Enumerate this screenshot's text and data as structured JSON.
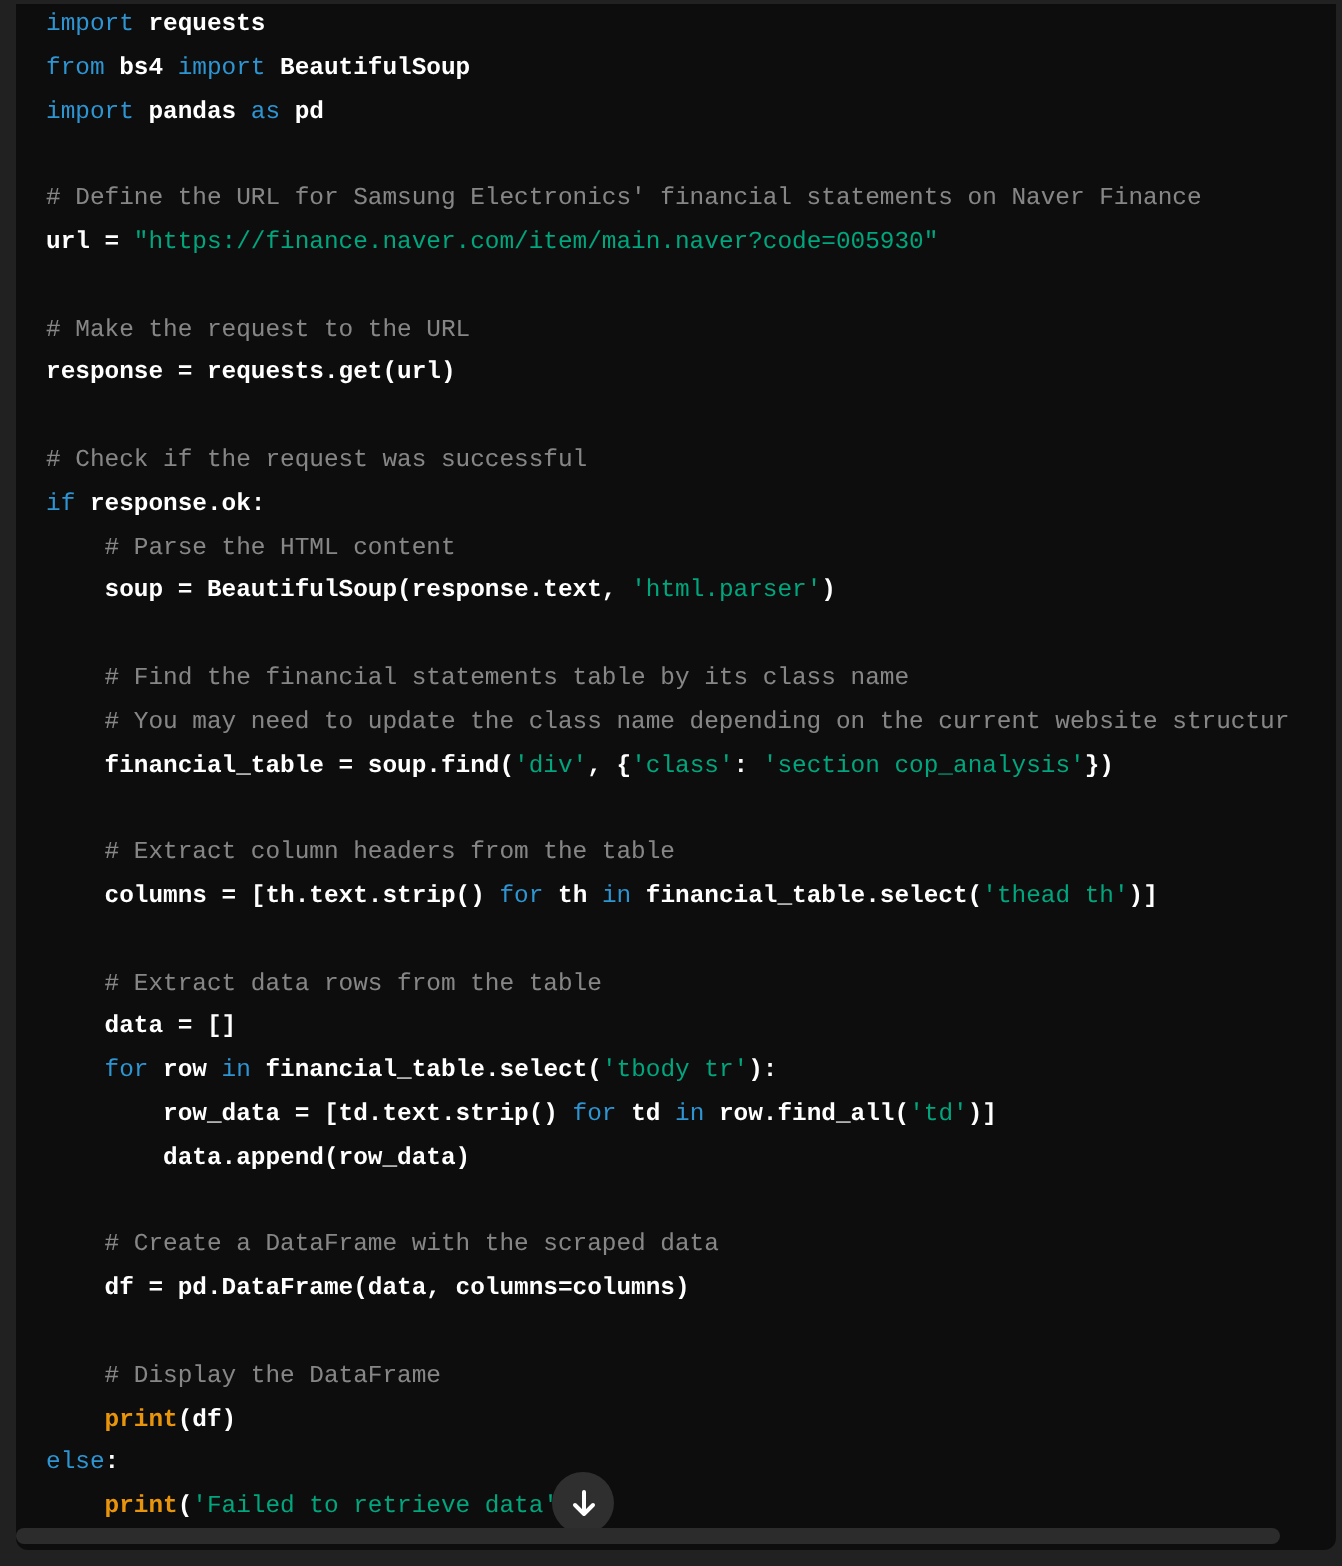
{
  "code_block": {
    "lines": [
      {
        "kind": "code",
        "tokens": [
          {
            "kind": "keyword",
            "text": "import"
          },
          {
            "kind": "plain",
            "text": " requests"
          }
        ]
      },
      {
        "kind": "code",
        "tokens": [
          {
            "kind": "keyword",
            "text": "from"
          },
          {
            "kind": "plain",
            "text": " bs4 "
          },
          {
            "kind": "keyword",
            "text": "import"
          },
          {
            "kind": "plain",
            "text": " BeautifulSoup"
          }
        ]
      },
      {
        "kind": "code",
        "tokens": [
          {
            "kind": "keyword",
            "text": "import"
          },
          {
            "kind": "plain",
            "text": " pandas "
          },
          {
            "kind": "keyword",
            "text": "as"
          },
          {
            "kind": "plain",
            "text": " pd"
          }
        ]
      },
      {
        "kind": "blank"
      },
      {
        "kind": "code",
        "tokens": [
          {
            "kind": "comment",
            "text": "# Define the URL for Samsung Electronics' financial statements on Naver Finance"
          }
        ]
      },
      {
        "kind": "code",
        "tokens": [
          {
            "kind": "plain",
            "text": "url = "
          },
          {
            "kind": "string",
            "text": "\"https://finance.naver.com/item/main.naver?code=005930\""
          }
        ]
      },
      {
        "kind": "blank"
      },
      {
        "kind": "code",
        "tokens": [
          {
            "kind": "comment",
            "text": "# Make the request to the URL"
          }
        ]
      },
      {
        "kind": "code",
        "tokens": [
          {
            "kind": "plain",
            "text": "response = requests.get(url)"
          }
        ]
      },
      {
        "kind": "blank"
      },
      {
        "kind": "code",
        "tokens": [
          {
            "kind": "comment",
            "text": "# Check if the request was successful"
          }
        ]
      },
      {
        "kind": "code",
        "tokens": [
          {
            "kind": "keyword",
            "text": "if"
          },
          {
            "kind": "plain",
            "text": " response.ok:"
          }
        ]
      },
      {
        "kind": "code",
        "tokens": [
          {
            "kind": "comment",
            "text": "    # Parse the HTML content"
          }
        ]
      },
      {
        "kind": "code",
        "tokens": [
          {
            "kind": "plain",
            "text": "    soup = BeautifulSoup(response.text, "
          },
          {
            "kind": "string",
            "text": "'html.parser'"
          },
          {
            "kind": "plain",
            "text": ")"
          }
        ]
      },
      {
        "kind": "blank"
      },
      {
        "kind": "code",
        "tokens": [
          {
            "kind": "comment",
            "text": "    # Find the financial statements table by its class name"
          }
        ]
      },
      {
        "kind": "code",
        "tokens": [
          {
            "kind": "comment",
            "text": "    # You may need to update the class name depending on the current website structur"
          }
        ]
      },
      {
        "kind": "code",
        "tokens": [
          {
            "kind": "plain",
            "text": "    financial_table = soup.find("
          },
          {
            "kind": "string",
            "text": "'div'"
          },
          {
            "kind": "plain",
            "text": ", {"
          },
          {
            "kind": "string",
            "text": "'class'"
          },
          {
            "kind": "plain",
            "text": ": "
          },
          {
            "kind": "string",
            "text": "'section cop_analysis'"
          },
          {
            "kind": "plain",
            "text": "})"
          }
        ]
      },
      {
        "kind": "blank"
      },
      {
        "kind": "code",
        "tokens": [
          {
            "kind": "comment",
            "text": "    # Extract column headers from the table"
          }
        ]
      },
      {
        "kind": "code",
        "tokens": [
          {
            "kind": "plain",
            "text": "    columns = [th.text.strip() "
          },
          {
            "kind": "keyword",
            "text": "for"
          },
          {
            "kind": "plain",
            "text": " th "
          },
          {
            "kind": "keyword",
            "text": "in"
          },
          {
            "kind": "plain",
            "text": " financial_table.select("
          },
          {
            "kind": "string",
            "text": "'thead th'"
          },
          {
            "kind": "plain",
            "text": ")]"
          }
        ]
      },
      {
        "kind": "blank"
      },
      {
        "kind": "code",
        "tokens": [
          {
            "kind": "comment",
            "text": "    # Extract data rows from the table"
          }
        ]
      },
      {
        "kind": "code",
        "tokens": [
          {
            "kind": "plain",
            "text": "    data = []"
          }
        ]
      },
      {
        "kind": "code",
        "tokens": [
          {
            "kind": "keyword",
            "text": "    for"
          },
          {
            "kind": "plain",
            "text": " row "
          },
          {
            "kind": "keyword",
            "text": "in"
          },
          {
            "kind": "plain",
            "text": " financial_table.select("
          },
          {
            "kind": "string",
            "text": "'tbody tr'"
          },
          {
            "kind": "plain",
            "text": "):"
          }
        ]
      },
      {
        "kind": "code",
        "tokens": [
          {
            "kind": "plain",
            "text": "        row_data = [td.text.strip() "
          },
          {
            "kind": "keyword",
            "text": "for"
          },
          {
            "kind": "plain",
            "text": " td "
          },
          {
            "kind": "keyword",
            "text": "in"
          },
          {
            "kind": "plain",
            "text": " row.find_all("
          },
          {
            "kind": "string",
            "text": "'td'"
          },
          {
            "kind": "plain",
            "text": ")]"
          }
        ]
      },
      {
        "kind": "code",
        "tokens": [
          {
            "kind": "plain",
            "text": "        data.append(row_data)"
          }
        ]
      },
      {
        "kind": "blank"
      },
      {
        "kind": "code",
        "tokens": [
          {
            "kind": "comment",
            "text": "    # Create a DataFrame with the scraped data"
          }
        ]
      },
      {
        "kind": "code",
        "tokens": [
          {
            "kind": "plain",
            "text": "    df = pd.DataFrame(data, columns=columns)"
          }
        ]
      },
      {
        "kind": "blank"
      },
      {
        "kind": "code",
        "tokens": [
          {
            "kind": "comment",
            "text": "    # Display the DataFrame"
          }
        ]
      },
      {
        "kind": "code",
        "tokens": [
          {
            "kind": "builtin",
            "text": "    print"
          },
          {
            "kind": "plain",
            "text": "(df)"
          }
        ]
      },
      {
        "kind": "code",
        "tokens": [
          {
            "kind": "keyword",
            "text": "else"
          },
          {
            "kind": "plain",
            "text": ":"
          }
        ]
      },
      {
        "kind": "code",
        "tokens": [
          {
            "kind": "builtin",
            "text": "    print"
          },
          {
            "kind": "plain",
            "text": "("
          },
          {
            "kind": "string",
            "text": "'Failed to retrieve data'"
          }
        ]
      }
    ]
  }
}
